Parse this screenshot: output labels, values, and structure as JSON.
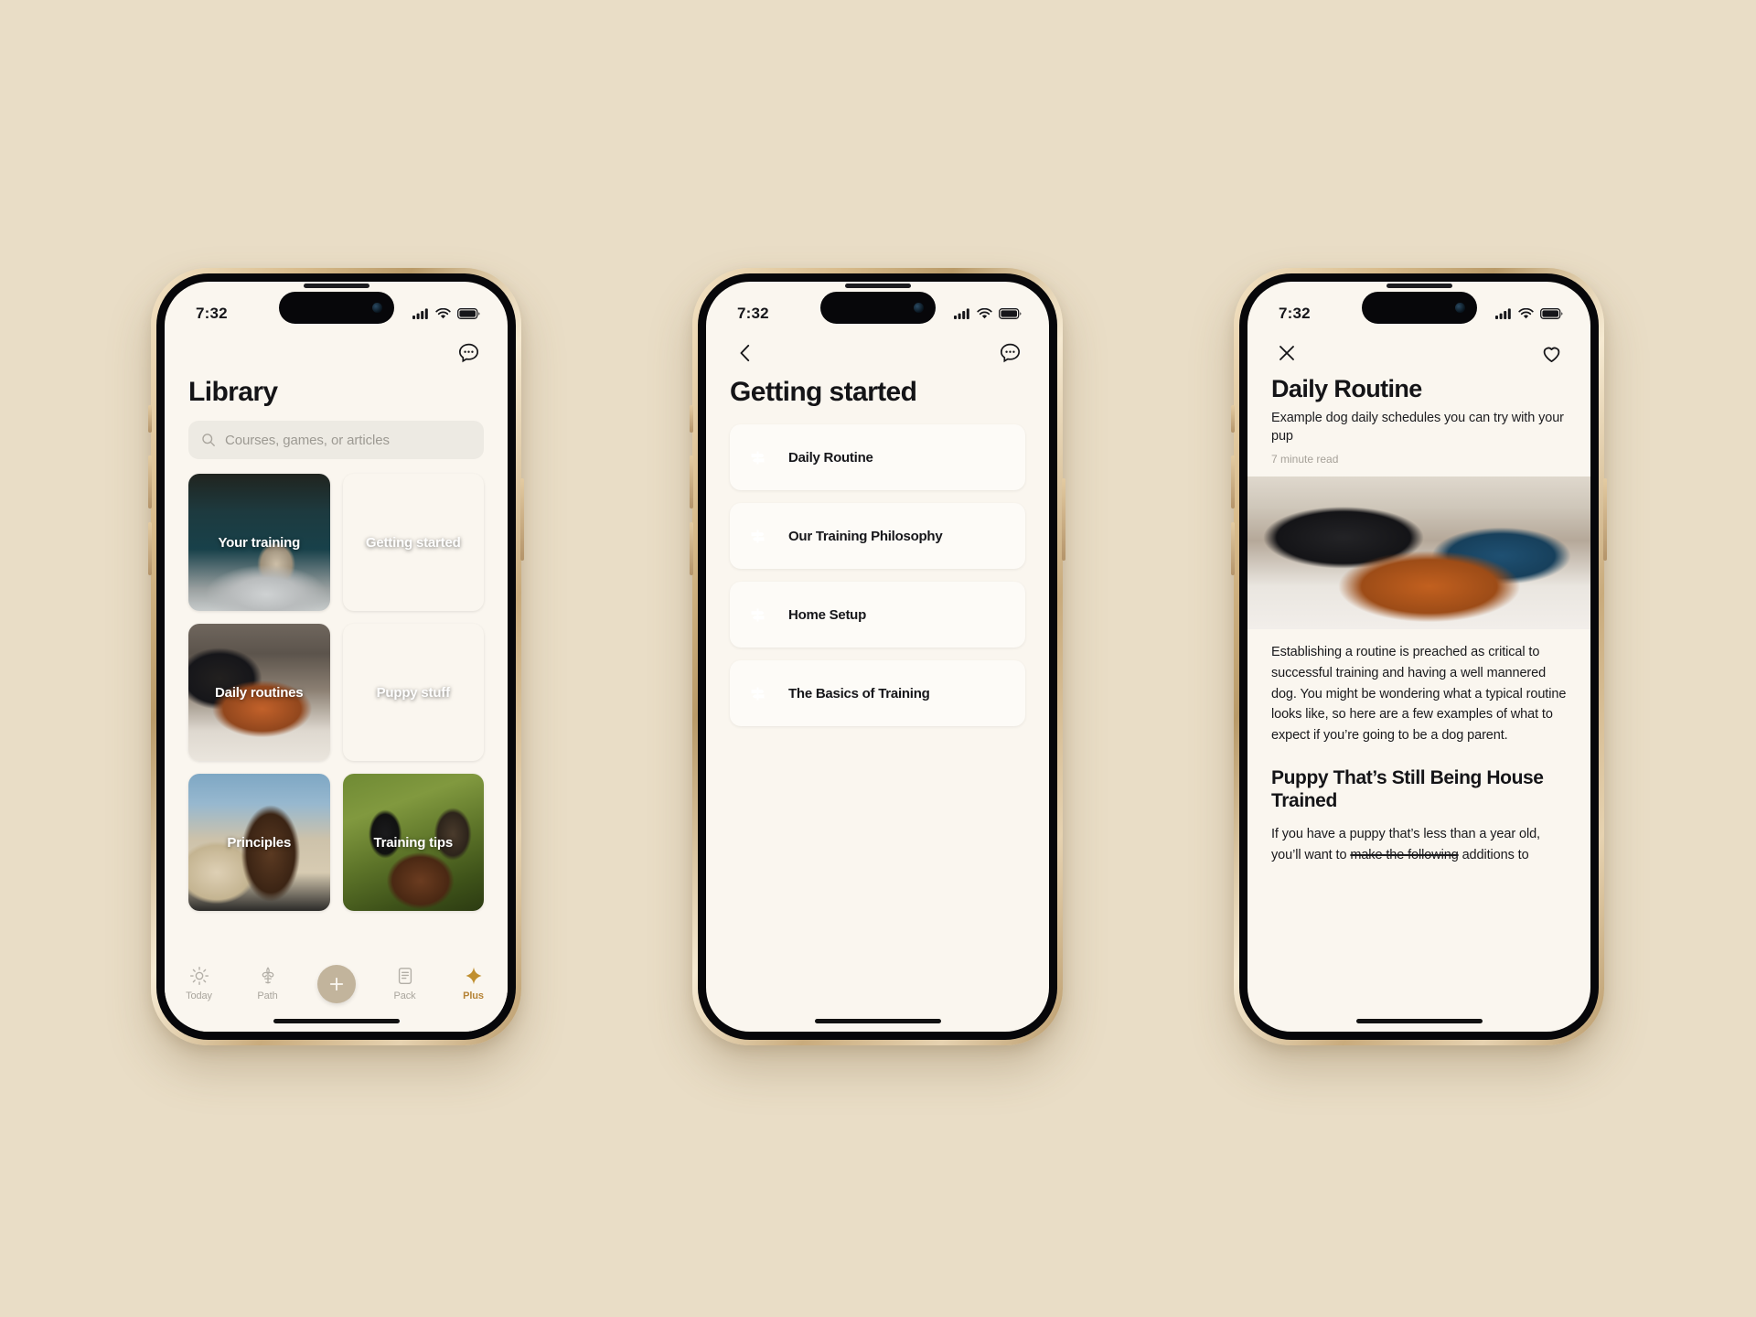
{
  "background_color": "#e9ddc6",
  "screen_color": "#faf6ef",
  "accent_gold": "#b58336",
  "icon_blue": "#0e4363",
  "status_bar": {
    "time": "7:32",
    "cellular_icon": "signal-bars-icon",
    "wifi_icon": "wifi-icon",
    "battery_icon": "battery-icon"
  },
  "phone1": {
    "chat_icon": "chat-bubble-icon",
    "title": "Library",
    "search": {
      "placeholder": "Courses, games, or articles",
      "value": "",
      "icon": "search-icon"
    },
    "tiles": [
      {
        "label": "Your training",
        "art": "art-training"
      },
      {
        "label": "Getting started",
        "art": "art-getting"
      },
      {
        "label": "Daily routines",
        "art": "art-daily"
      },
      {
        "label": "Puppy stuff",
        "art": "art-puppy"
      },
      {
        "label": "Principles",
        "art": "art-principles"
      },
      {
        "label": "Training tips",
        "art": "art-tips"
      }
    ],
    "tabs": [
      {
        "label": "Today",
        "icon": "sun-icon",
        "active": false
      },
      {
        "label": "Path",
        "icon": "fleur-de-lis-icon",
        "active": false
      },
      {
        "label": "",
        "icon": "plus-icon",
        "active": false
      },
      {
        "label": "Pack",
        "icon": "document-icon",
        "active": false
      },
      {
        "label": "Plus",
        "icon": "sparkle-star-icon",
        "active": true
      }
    ]
  },
  "phone2": {
    "back_icon": "chevron-left-icon",
    "chat_icon": "chat-bubble-icon",
    "title": "Getting started",
    "rows": [
      {
        "label": "Daily Routine",
        "icon": "signpost-icon"
      },
      {
        "label": "Our Training Philosophy",
        "icon": "signpost-icon"
      },
      {
        "label": "Home Setup",
        "icon": "signpost-icon"
      },
      {
        "label": "The Basics of Training",
        "icon": "signpost-icon"
      }
    ]
  },
  "phone3": {
    "close_icon": "close-x-icon",
    "favorite_icon": "heart-outline-icon",
    "title": "Daily Routine",
    "subtitle": "Example dog daily schedules you can try with your pup",
    "read_time": "7 minute read",
    "hero_alt": "person lying on bed with golden dog",
    "paragraph1": "Establishing a routine is preached as critical to successful training and having a well mannered dog. You might be wondering what a typical routine looks like, so here are a few examples of what to expect if you’re going to be a dog parent.",
    "heading1": "Puppy That’s Still Being House Trained",
    "paragraph2_part1": "If you have a puppy that’s less than a year old, you’ll want to ",
    "paragraph2_strike": "make the following",
    "paragraph2_part2": " additions to"
  }
}
